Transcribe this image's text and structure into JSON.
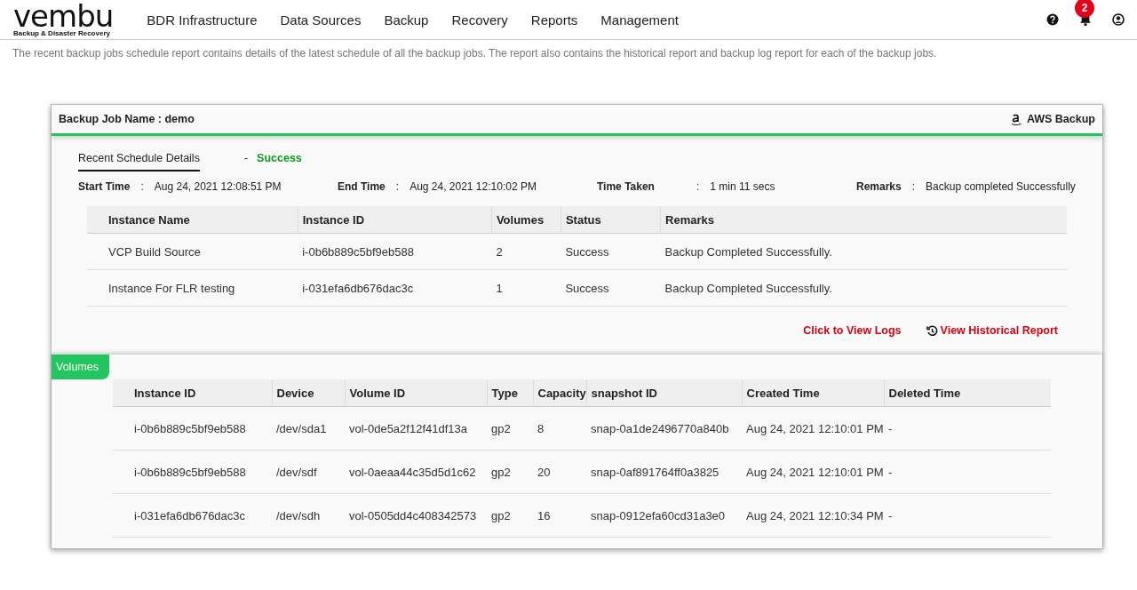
{
  "header": {
    "logo": "vembu",
    "tagline": "Backup & Disaster Recovery",
    "nav": [
      "BDR Infrastructure",
      "Data Sources",
      "Backup",
      "Recovery",
      "Reports",
      "Management"
    ],
    "notifications": "2"
  },
  "description": "The recent backup jobs schedule report contains details of the latest schedule of all the backup jobs. The report also contains the historical report and backup log report for each of the backup jobs.",
  "job": {
    "title": "Backup Job Name : demo",
    "type": "AWS Backup",
    "section": "Recent Schedule Details",
    "status_sep": "-",
    "status": "Success",
    "summary": [
      {
        "label": "Start Time",
        "sep": ":",
        "value": "Aug 24, 2021 12:08:51 PM"
      },
      {
        "label": "End Time",
        "sep": ":",
        "value": "Aug 24, 2021 12:10:02 PM"
      },
      {
        "label": "Time Taken",
        "sep": ":",
        "value": "1 min 11 secs"
      },
      {
        "label": "Remarks",
        "sep": ":",
        "value": "Backup completed Successfully"
      }
    ],
    "instances": {
      "columns": [
        "Instance Name",
        "Instance ID",
        "Volumes",
        "Status",
        "Remarks"
      ],
      "rows": [
        [
          "VCP Build Source",
          "i-0b6b889c5bf9eb588",
          "2",
          "Success",
          "Backup Completed Successfully."
        ],
        [
          "Instance For FLR testing",
          "i-031efa6db676dac3c",
          "1",
          "Success",
          "Backup Completed Successfully."
        ]
      ]
    },
    "links": [
      "Click to View Logs",
      "View Historical Report"
    ],
    "volumes_tab": "Volumes",
    "volumes": {
      "columns": [
        "Instance ID",
        "Device",
        "Volume ID",
        "Type",
        "Capacity",
        "snapshot ID",
        "Created Time",
        "Deleted Time"
      ],
      "rows": [
        [
          "i-0b6b889c5bf9eb588",
          "/dev/sda1",
          "vol-0de5a2f12f41df13a",
          "gp2",
          "8",
          "snap-0a1de2496770a840b",
          "Aug 24, 2021 12:10:01 PM",
          "-"
        ],
        [
          "i-0b6b889c5bf9eb588",
          "/dev/sdf",
          "vol-0aeaa44c35d5d1c62",
          "gp2",
          "20",
          "snap-0af891764ff0a3825",
          "Aug 24, 2021 12:10:01 PM",
          "-"
        ],
        [
          "i-031efa6db676dac3c",
          "/dev/sdh",
          "vol-0505dd4c408342573",
          "gp2",
          "16",
          "snap-0912efa60cd31a3e0",
          "Aug 24, 2021 12:10:34 PM",
          "-"
        ]
      ]
    }
  }
}
